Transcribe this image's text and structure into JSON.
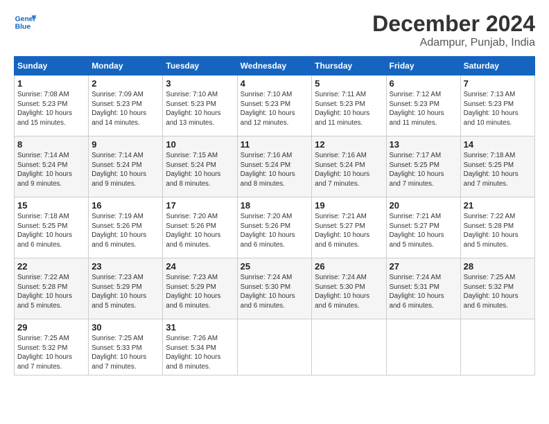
{
  "logo": {
    "line1": "General",
    "line2": "Blue"
  },
  "title": "December 2024",
  "location": "Adampur, Punjab, India",
  "days_of_week": [
    "Sunday",
    "Monday",
    "Tuesday",
    "Wednesday",
    "Thursday",
    "Friday",
    "Saturday"
  ],
  "weeks": [
    [
      {
        "day": "1",
        "info": "Sunrise: 7:08 AM\nSunset: 5:23 PM\nDaylight: 10 hours\nand 15 minutes."
      },
      {
        "day": "2",
        "info": "Sunrise: 7:09 AM\nSunset: 5:23 PM\nDaylight: 10 hours\nand 14 minutes."
      },
      {
        "day": "3",
        "info": "Sunrise: 7:10 AM\nSunset: 5:23 PM\nDaylight: 10 hours\nand 13 minutes."
      },
      {
        "day": "4",
        "info": "Sunrise: 7:10 AM\nSunset: 5:23 PM\nDaylight: 10 hours\nand 12 minutes."
      },
      {
        "day": "5",
        "info": "Sunrise: 7:11 AM\nSunset: 5:23 PM\nDaylight: 10 hours\nand 11 minutes."
      },
      {
        "day": "6",
        "info": "Sunrise: 7:12 AM\nSunset: 5:23 PM\nDaylight: 10 hours\nand 11 minutes."
      },
      {
        "day": "7",
        "info": "Sunrise: 7:13 AM\nSunset: 5:23 PM\nDaylight: 10 hours\nand 10 minutes."
      }
    ],
    [
      {
        "day": "8",
        "info": "Sunrise: 7:14 AM\nSunset: 5:24 PM\nDaylight: 10 hours\nand 9 minutes."
      },
      {
        "day": "9",
        "info": "Sunrise: 7:14 AM\nSunset: 5:24 PM\nDaylight: 10 hours\nand 9 minutes."
      },
      {
        "day": "10",
        "info": "Sunrise: 7:15 AM\nSunset: 5:24 PM\nDaylight: 10 hours\nand 8 minutes."
      },
      {
        "day": "11",
        "info": "Sunrise: 7:16 AM\nSunset: 5:24 PM\nDaylight: 10 hours\nand 8 minutes."
      },
      {
        "day": "12",
        "info": "Sunrise: 7:16 AM\nSunset: 5:24 PM\nDaylight: 10 hours\nand 7 minutes."
      },
      {
        "day": "13",
        "info": "Sunrise: 7:17 AM\nSunset: 5:25 PM\nDaylight: 10 hours\nand 7 minutes."
      },
      {
        "day": "14",
        "info": "Sunrise: 7:18 AM\nSunset: 5:25 PM\nDaylight: 10 hours\nand 7 minutes."
      }
    ],
    [
      {
        "day": "15",
        "info": "Sunrise: 7:18 AM\nSunset: 5:25 PM\nDaylight: 10 hours\nand 6 minutes."
      },
      {
        "day": "16",
        "info": "Sunrise: 7:19 AM\nSunset: 5:26 PM\nDaylight: 10 hours\nand 6 minutes."
      },
      {
        "day": "17",
        "info": "Sunrise: 7:20 AM\nSunset: 5:26 PM\nDaylight: 10 hours\nand 6 minutes."
      },
      {
        "day": "18",
        "info": "Sunrise: 7:20 AM\nSunset: 5:26 PM\nDaylight: 10 hours\nand 6 minutes."
      },
      {
        "day": "19",
        "info": "Sunrise: 7:21 AM\nSunset: 5:27 PM\nDaylight: 10 hours\nand 6 minutes."
      },
      {
        "day": "20",
        "info": "Sunrise: 7:21 AM\nSunset: 5:27 PM\nDaylight: 10 hours\nand 5 minutes."
      },
      {
        "day": "21",
        "info": "Sunrise: 7:22 AM\nSunset: 5:28 PM\nDaylight: 10 hours\nand 5 minutes."
      }
    ],
    [
      {
        "day": "22",
        "info": "Sunrise: 7:22 AM\nSunset: 5:28 PM\nDaylight: 10 hours\nand 5 minutes."
      },
      {
        "day": "23",
        "info": "Sunrise: 7:23 AM\nSunset: 5:29 PM\nDaylight: 10 hours\nand 5 minutes."
      },
      {
        "day": "24",
        "info": "Sunrise: 7:23 AM\nSunset: 5:29 PM\nDaylight: 10 hours\nand 6 minutes."
      },
      {
        "day": "25",
        "info": "Sunrise: 7:24 AM\nSunset: 5:30 PM\nDaylight: 10 hours\nand 6 minutes."
      },
      {
        "day": "26",
        "info": "Sunrise: 7:24 AM\nSunset: 5:30 PM\nDaylight: 10 hours\nand 6 minutes."
      },
      {
        "day": "27",
        "info": "Sunrise: 7:24 AM\nSunset: 5:31 PM\nDaylight: 10 hours\nand 6 minutes."
      },
      {
        "day": "28",
        "info": "Sunrise: 7:25 AM\nSunset: 5:32 PM\nDaylight: 10 hours\nand 6 minutes."
      }
    ],
    [
      {
        "day": "29",
        "info": "Sunrise: 7:25 AM\nSunset: 5:32 PM\nDaylight: 10 hours\nand 7 minutes."
      },
      {
        "day": "30",
        "info": "Sunrise: 7:25 AM\nSunset: 5:33 PM\nDaylight: 10 hours\nand 7 minutes."
      },
      {
        "day": "31",
        "info": "Sunrise: 7:26 AM\nSunset: 5:34 PM\nDaylight: 10 hours\nand 8 minutes."
      },
      {
        "day": "",
        "info": ""
      },
      {
        "day": "",
        "info": ""
      },
      {
        "day": "",
        "info": ""
      },
      {
        "day": "",
        "info": ""
      }
    ]
  ]
}
